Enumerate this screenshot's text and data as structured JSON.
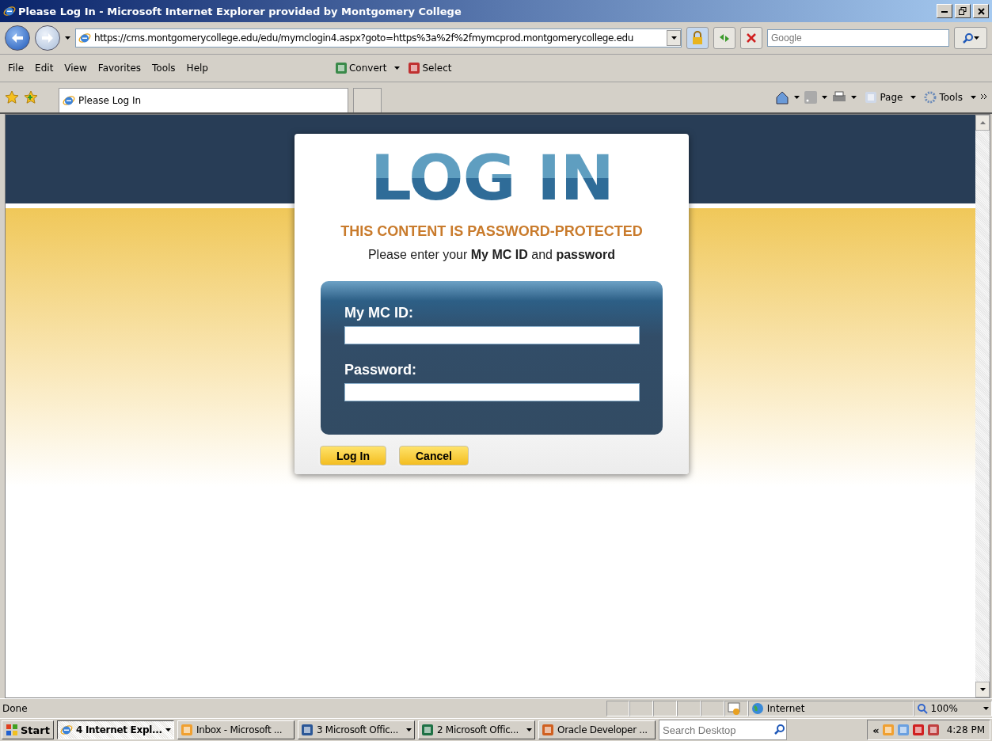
{
  "window": {
    "title": "Please Log In - Microsoft Internet Explorer provided by Montgomery College"
  },
  "address_bar": {
    "url": "https://cms.montgomerycollege.edu/edu/mymclogin4.aspx?goto=https%3a%2f%2fmymcprod.montgomerycollege.edu",
    "search_placeholder": "Google"
  },
  "menu": [
    "File",
    "Edit",
    "View",
    "Favorites",
    "Tools",
    "Help"
  ],
  "pdf_tools": [
    "Convert",
    "Select"
  ],
  "tab": {
    "title": "Please Log In"
  },
  "command_bar": [
    "Page",
    "Tools"
  ],
  "login": {
    "heading": "LOG IN",
    "notice": "THIS CONTENT IS PASSWORD-PROTECTED",
    "instructions": "Please enter your **My MC ID** and **password**",
    "fields": [
      {
        "label": "My MC ID:"
      },
      {
        "label": "Password:"
      }
    ],
    "buttons": [
      "Log In",
      "Cancel"
    ]
  },
  "status_bar": {
    "text": "Done",
    "zone": "Internet",
    "zoom": "100%"
  },
  "taskbar": {
    "start": "Start",
    "items": [
      {
        "kind": "ie",
        "label": "4 Internet Expl...",
        "selected": true,
        "group": true
      },
      {
        "kind": "outlook",
        "label": "Inbox - Microsoft ...",
        "selected": false,
        "group": false
      },
      {
        "kind": "word",
        "label": "3 Microsoft Offic...",
        "selected": false,
        "group": true
      },
      {
        "kind": "excel",
        "label": "2 Microsoft Offic...",
        "selected": false,
        "group": true
      },
      {
        "kind": "java",
        "label": "Oracle Developer ...",
        "selected": false,
        "group": false
      }
    ],
    "search_placeholder": "Search Desktop",
    "tray_expand": "«",
    "clock": "4:28 PM"
  }
}
